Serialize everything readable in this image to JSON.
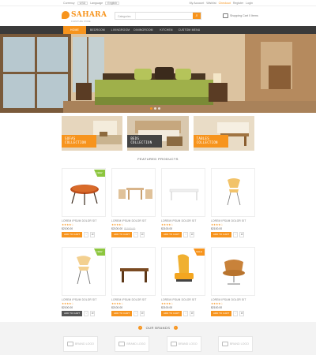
{
  "topbar": {
    "currency_label": "Currency",
    "currency_value": "USD",
    "language_label": "Language",
    "language_value": "English",
    "links": [
      "My Account",
      "Wishlist",
      "Checkout",
      "Register",
      "Login"
    ]
  },
  "header": {
    "logo": "SAHARA",
    "tagline": "FURNITURE STORE",
    "search": {
      "category": "Categories",
      "placeholder": ""
    },
    "cart_text": "Shopping Cart 0 Items"
  },
  "nav": {
    "items": [
      "HOME",
      "BEDROOM",
      "LIVINGROOM",
      "DININGROOM",
      "KITCHEN",
      "CUSTOM MENU"
    ]
  },
  "categories": [
    {
      "line1": "SOFAS",
      "line2": "COLLECTION"
    },
    {
      "line1": "BEDS",
      "line2": "COLLECTION"
    },
    {
      "line1": "TABLES",
      "line2": "COLLECTION"
    }
  ],
  "featured_title": "FEATURED PRODUCTS",
  "products": [
    {
      "name": "LOREM IPSUM DOLOR SIT",
      "stars": "★★★★☆",
      "price": "$2100.00",
      "old": "",
      "badge": "NEW",
      "btn": "ADD TO CART"
    },
    {
      "name": "LOREM IPSUM DOLOR SIT",
      "stars": "★★★★☆",
      "price": "$2100.00",
      "old": "$1000.00",
      "badge": "",
      "btn": "ADD TO CART"
    },
    {
      "name": "LOREM IPSUM DOLOR SIT",
      "stars": "★★★★☆",
      "price": "$2100.00",
      "old": "",
      "badge": "",
      "btn": "ADD TO CART"
    },
    {
      "name": "LOREM IPSUM DOLOR SIT",
      "stars": "★★★★☆",
      "price": "$2100.00",
      "old": "",
      "badge": "",
      "btn": "ADD TO CART"
    },
    {
      "name": "LOREM IPSUM DOLOR SIT",
      "stars": "★★★★☆",
      "price": "$2100.00",
      "old": "",
      "badge": "NEW",
      "btn": "ADD TO CART"
    },
    {
      "name": "LOREM IPSUM DOLOR SIT",
      "stars": "★★★★☆",
      "price": "$2100.00",
      "old": "",
      "badge": "",
      "btn": "ADD TO CART"
    },
    {
      "name": "LOREM IPSUM DOLOR SIT",
      "stars": "★★★★☆",
      "price": "$2100.00",
      "old": "",
      "badge": "SALE",
      "btn": "ADD TO CART"
    },
    {
      "name": "LOREM IPSUM DOLOR SIT",
      "stars": "★★★★☆",
      "price": "$2100.00",
      "old": "",
      "badge": "",
      "btn": "ADD TO CART"
    }
  ],
  "brands": {
    "title": "OUR BRANDS",
    "items": [
      "BRAND LOGO",
      "BRAND LOGO",
      "BRAND LOGO",
      "BRAND LOGO"
    ]
  },
  "colors": {
    "accent": "#f7941d",
    "nav_bg": "#3a3a3a",
    "badge_new": "#8dc63f"
  }
}
